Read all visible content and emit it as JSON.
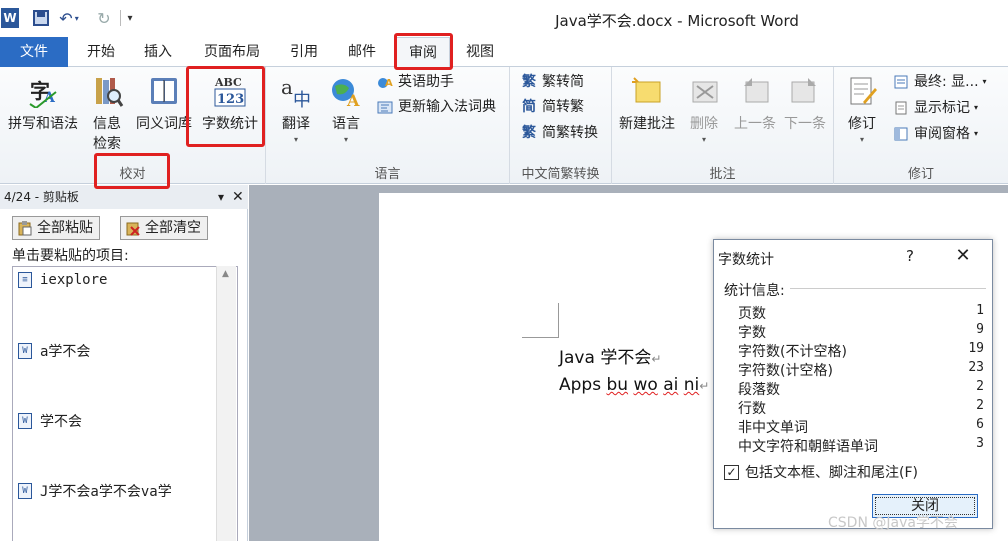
{
  "window": {
    "title": "Java学不会.docx  -  Microsoft Word",
    "app_icon": "word-icon"
  },
  "quick_access": [
    "save-icon",
    "undo-icon",
    "redo-icon",
    "customize-icon"
  ],
  "tabs": [
    {
      "label": "文件",
      "active": false
    },
    {
      "label": "开始",
      "active": false
    },
    {
      "label": "插入",
      "active": false
    },
    {
      "label": "页面布局",
      "active": false
    },
    {
      "label": "引用",
      "active": false
    },
    {
      "label": "邮件",
      "active": false
    },
    {
      "label": "审阅",
      "active": true
    },
    {
      "label": "视图",
      "active": false
    }
  ],
  "ribbon": {
    "proofing": {
      "label": "校对",
      "spelling": "拼写和语法",
      "research_line1": "信息",
      "research_line2": "检索",
      "thesaurus": "同义词库",
      "word_count": "字数统计"
    },
    "language": {
      "label": "语言",
      "translate": "翻译",
      "language": "语言",
      "english_assistant": "英语助手",
      "update_ime": "更新输入法词典"
    },
    "chinese_conversion": {
      "label": "中文简繁转换",
      "to_traditional": "繁转简",
      "to_simplified": "简转繁",
      "convert": "简繁转换"
    },
    "comments": {
      "label": "批注",
      "new": "新建批注",
      "delete": "删除",
      "previous": "上一条",
      "next": "下一条"
    },
    "tracking": {
      "label": "修订",
      "track_changes": "修订",
      "display": "最终: 显...",
      "show_markup": "显示标记",
      "reviewing_pane": "审阅窗格"
    }
  },
  "clipboard_pane": {
    "title": "4/24 - 剪贴板",
    "paste_all": "全部粘贴",
    "clear_all": "全部清空",
    "hint": "单击要粘贴的项目:",
    "items": [
      "iexplore",
      "a学不会",
      "学不会",
      "J学不会a学不会va学"
    ]
  },
  "document": {
    "line1": "Java 学不会",
    "line2_a": "Apps ",
    "line2_b": "bu",
    "line2_c": " ",
    "line2_d": "wo",
    "line2_e": " ",
    "line2_f": "ai",
    "line2_g": " ",
    "line2_h": "ni",
    "para_mark": "↵"
  },
  "word_count_dialog": {
    "title": "字数统计",
    "help": "?",
    "close_glyph": "✕",
    "stats_label": "统计信息:",
    "stats": [
      {
        "label": "页数",
        "value": "1"
      },
      {
        "label": "字数",
        "value": "9"
      },
      {
        "label": "字符数(不计空格)",
        "value": "19"
      },
      {
        "label": "字符数(计空格)",
        "value": "23"
      },
      {
        "label": "段落数",
        "value": "2"
      },
      {
        "label": "行数",
        "value": "2"
      },
      {
        "label": "非中文单词",
        "value": "6"
      },
      {
        "label": "中文字符和朝鲜语单词",
        "value": "3"
      }
    ],
    "include_label": "包括文本框、脚注和尾注(F)",
    "include_checked": true,
    "close_button": "关闭"
  },
  "watermark": "CSDN @Java学不会",
  "colors": {
    "file_tab": "#2b6cc4",
    "annotation_red": "#e02020",
    "ribbon_bg": "#eef2f6"
  }
}
